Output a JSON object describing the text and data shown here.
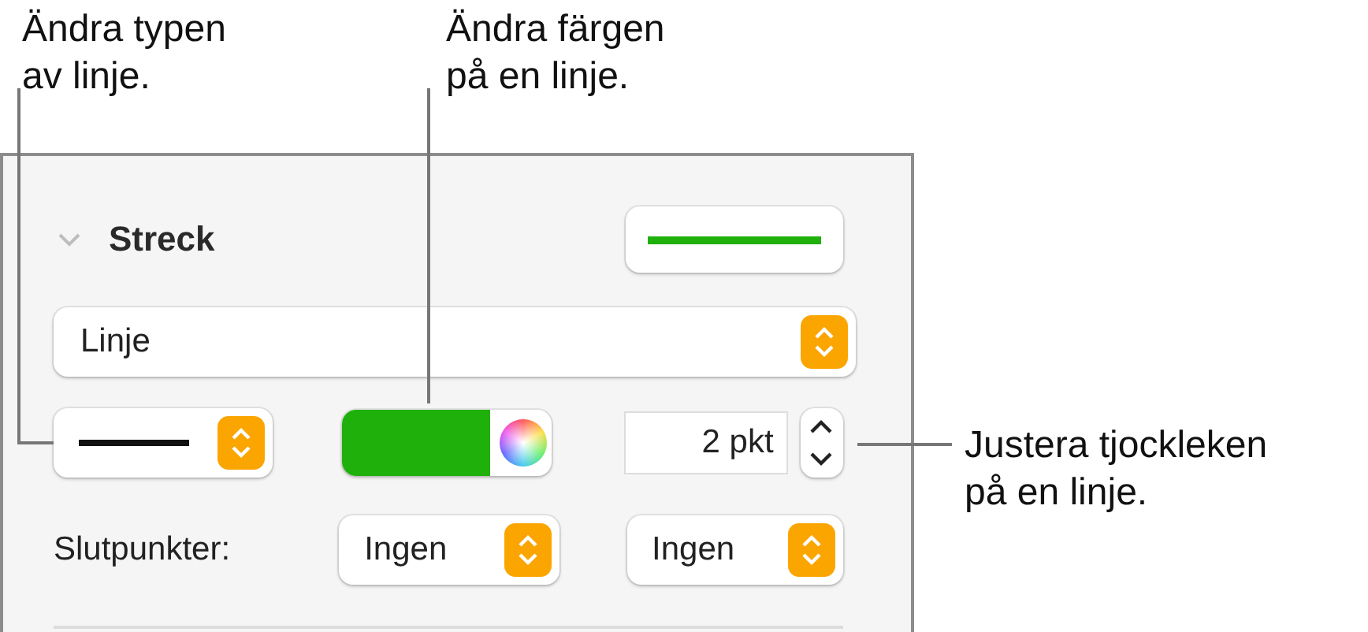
{
  "callouts": [
    {
      "text": "Ändra typen\nav linje."
    },
    {
      "text": "Ändra färgen\npå en linje."
    },
    {
      "text": "Justera tjockleken\npå en linje."
    }
  ],
  "section": {
    "title": "Streck",
    "expanded": true
  },
  "line_type": {
    "value": "Linje"
  },
  "width_field": {
    "value": "2 pkt"
  },
  "endpoints": {
    "label": "Slutpunkter:",
    "start": "Ingen",
    "end": "Ingen"
  }
}
